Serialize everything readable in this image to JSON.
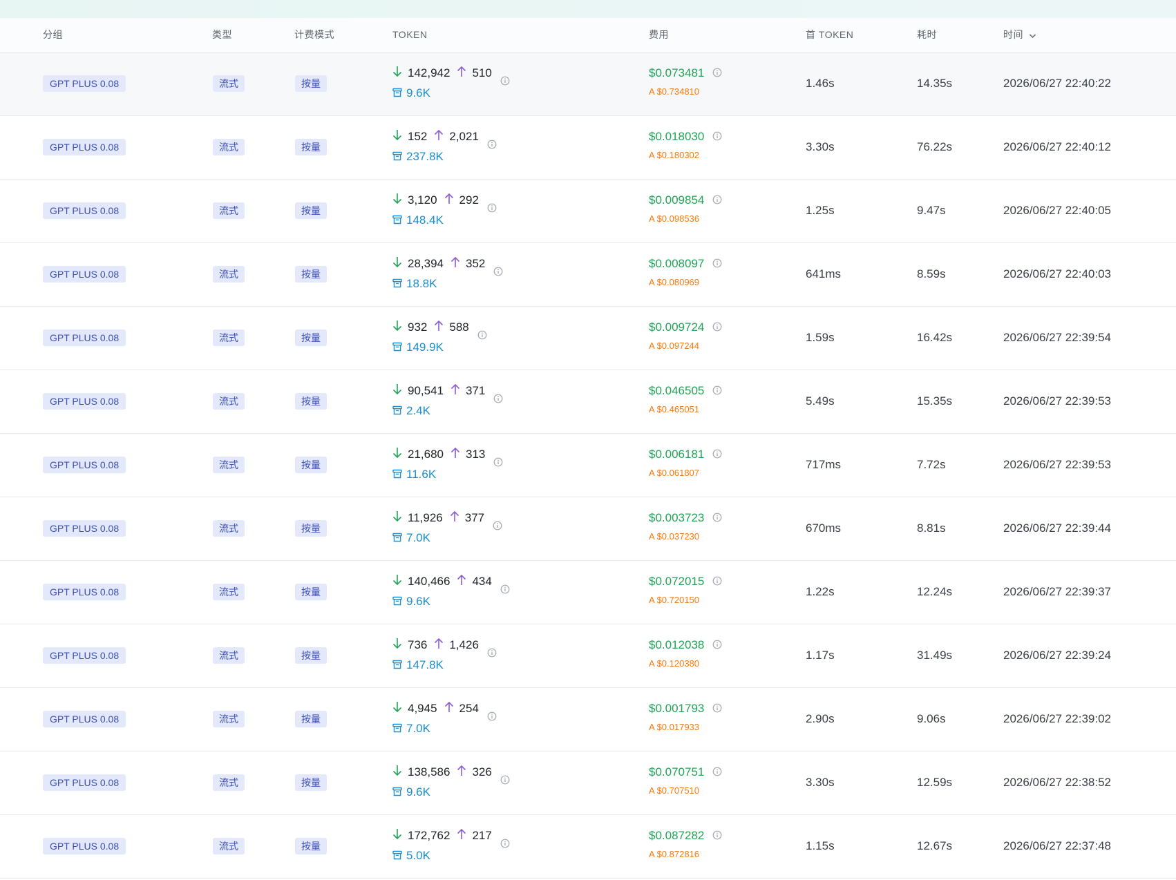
{
  "header": {
    "group": "分组",
    "type": "类型",
    "billing": "计费模式",
    "token": "TOKEN",
    "cost": "费用",
    "first_token": "首 TOKEN",
    "duration": "耗时",
    "time": "时间"
  },
  "colors": {
    "down_arrow": "#20a456",
    "up_arrow": "#8a5cd6",
    "cache": "#1a8fd1",
    "cost": "#20a456",
    "cost_sub": "#f57a10",
    "tag_bg": "#e4e8fb",
    "tag_text": "#3d4fb4"
  },
  "icons": {
    "down": "arrow-down-icon",
    "up": "arrow-up-icon",
    "cache": "cache-box-icon",
    "info": "info-circle-icon",
    "sort": "chevron-down-icon"
  },
  "rows": [
    {
      "group": "GPT PLUS 0.08",
      "type": "流式",
      "billing": "按量",
      "input": "142,942",
      "output": "510",
      "cache": "9.6K",
      "cost": "$0.073481",
      "cost_sub": "A $0.734810",
      "first": "1.46s",
      "duration": "14.35s",
      "time": "2026/06/27 22:40:22"
    },
    {
      "group": "GPT PLUS 0.08",
      "type": "流式",
      "billing": "按量",
      "input": "152",
      "output": "2,021",
      "cache": "237.8K",
      "cost": "$0.018030",
      "cost_sub": "A $0.180302",
      "first": "3.30s",
      "duration": "76.22s",
      "time": "2026/06/27 22:40:12"
    },
    {
      "group": "GPT PLUS 0.08",
      "type": "流式",
      "billing": "按量",
      "input": "3,120",
      "output": "292",
      "cache": "148.4K",
      "cost": "$0.009854",
      "cost_sub": "A $0.098536",
      "first": "1.25s",
      "duration": "9.47s",
      "time": "2026/06/27 22:40:05"
    },
    {
      "group": "GPT PLUS 0.08",
      "type": "流式",
      "billing": "按量",
      "input": "28,394",
      "output": "352",
      "cache": "18.8K",
      "cost": "$0.008097",
      "cost_sub": "A $0.080969",
      "first": "641ms",
      "duration": "8.59s",
      "time": "2026/06/27 22:40:03"
    },
    {
      "group": "GPT PLUS 0.08",
      "type": "流式",
      "billing": "按量",
      "input": "932",
      "output": "588",
      "cache": "149.9K",
      "cost": "$0.009724",
      "cost_sub": "A $0.097244",
      "first": "1.59s",
      "duration": "16.42s",
      "time": "2026/06/27 22:39:54"
    },
    {
      "group": "GPT PLUS 0.08",
      "type": "流式",
      "billing": "按量",
      "input": "90,541",
      "output": "371",
      "cache": "2.4K",
      "cost": "$0.046505",
      "cost_sub": "A $0.465051",
      "first": "5.49s",
      "duration": "15.35s",
      "time": "2026/06/27 22:39:53"
    },
    {
      "group": "GPT PLUS 0.08",
      "type": "流式",
      "billing": "按量",
      "input": "21,680",
      "output": "313",
      "cache": "11.6K",
      "cost": "$0.006181",
      "cost_sub": "A $0.061807",
      "first": "717ms",
      "duration": "7.72s",
      "time": "2026/06/27 22:39:53"
    },
    {
      "group": "GPT PLUS 0.08",
      "type": "流式",
      "billing": "按量",
      "input": "11,926",
      "output": "377",
      "cache": "7.0K",
      "cost": "$0.003723",
      "cost_sub": "A $0.037230",
      "first": "670ms",
      "duration": "8.81s",
      "time": "2026/06/27 22:39:44"
    },
    {
      "group": "GPT PLUS 0.08",
      "type": "流式",
      "billing": "按量",
      "input": "140,466",
      "output": "434",
      "cache": "9.6K",
      "cost": "$0.072015",
      "cost_sub": "A $0.720150",
      "first": "1.22s",
      "duration": "12.24s",
      "time": "2026/06/27 22:39:37"
    },
    {
      "group": "GPT PLUS 0.08",
      "type": "流式",
      "billing": "按量",
      "input": "736",
      "output": "1,426",
      "cache": "147.8K",
      "cost": "$0.012038",
      "cost_sub": "A $0.120380",
      "first": "1.17s",
      "duration": "31.49s",
      "time": "2026/06/27 22:39:24"
    },
    {
      "group": "GPT PLUS 0.08",
      "type": "流式",
      "billing": "按量",
      "input": "4,945",
      "output": "254",
      "cache": "7.0K",
      "cost": "$0.001793",
      "cost_sub": "A $0.017933",
      "first": "2.90s",
      "duration": "9.06s",
      "time": "2026/06/27 22:39:02"
    },
    {
      "group": "GPT PLUS 0.08",
      "type": "流式",
      "billing": "按量",
      "input": "138,586",
      "output": "326",
      "cache": "9.6K",
      "cost": "$0.070751",
      "cost_sub": "A $0.707510",
      "first": "3.30s",
      "duration": "12.59s",
      "time": "2026/06/27 22:38:52"
    },
    {
      "group": "GPT PLUS 0.08",
      "type": "流式",
      "billing": "按量",
      "input": "172,762",
      "output": "217",
      "cache": "5.0K",
      "cost": "$0.087282",
      "cost_sub": "A $0.872816",
      "first": "1.15s",
      "duration": "12.67s",
      "time": "2026/06/27 22:37:48"
    }
  ]
}
